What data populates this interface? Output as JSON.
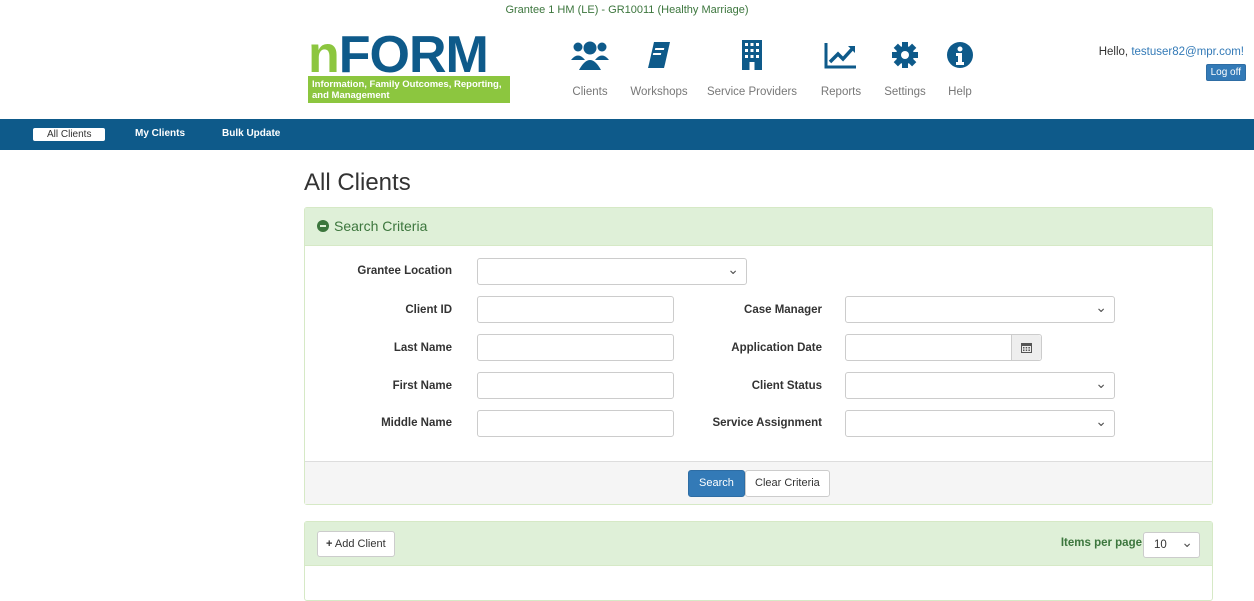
{
  "grantee": "Grantee 1 HM (LE) - GR10011 (Healthy Marriage)",
  "logo": {
    "n": "n",
    "form": "FORM",
    "tagline": "Information, Family Outcomes, Reporting, and Management"
  },
  "nav": [
    {
      "label": "Clients",
      "icon": "users-icon"
    },
    {
      "label": "Workshops",
      "icon": "book-icon"
    },
    {
      "label": "Service Providers",
      "icon": "building-icon"
    },
    {
      "label": "Reports",
      "icon": "chart-line-icon"
    },
    {
      "label": "Settings",
      "icon": "gear-icon"
    },
    {
      "label": "Help",
      "icon": "info-icon"
    }
  ],
  "user": {
    "greeting": "Hello, ",
    "username": "testuser82@mpr.com!",
    "logoff": "Log off"
  },
  "subnav": {
    "all_clients": "All Clients",
    "my_clients": "My Clients",
    "bulk_update": "Bulk Update"
  },
  "page_title": "All Clients",
  "search": {
    "header": "Search Criteria",
    "fields": {
      "grantee_location": "Grantee Location",
      "client_id": "Client ID",
      "last_name": "Last Name",
      "first_name": "First Name",
      "middle_name": "Middle Name",
      "case_manager": "Case Manager",
      "application_date": "Application Date",
      "client_status": "Client Status",
      "service_assignment": "Service Assignment"
    },
    "search_button": "Search",
    "clear_button": "Clear Criteria"
  },
  "results": {
    "add_client": "Add Client",
    "items_per_page_label": "Items per page",
    "items_per_page_value": "10"
  },
  "colors": {
    "brand_blue": "#0e5a8a",
    "brand_green": "#8cc63f",
    "panel_green": "#dff0d8",
    "button_blue": "#337ab7"
  }
}
